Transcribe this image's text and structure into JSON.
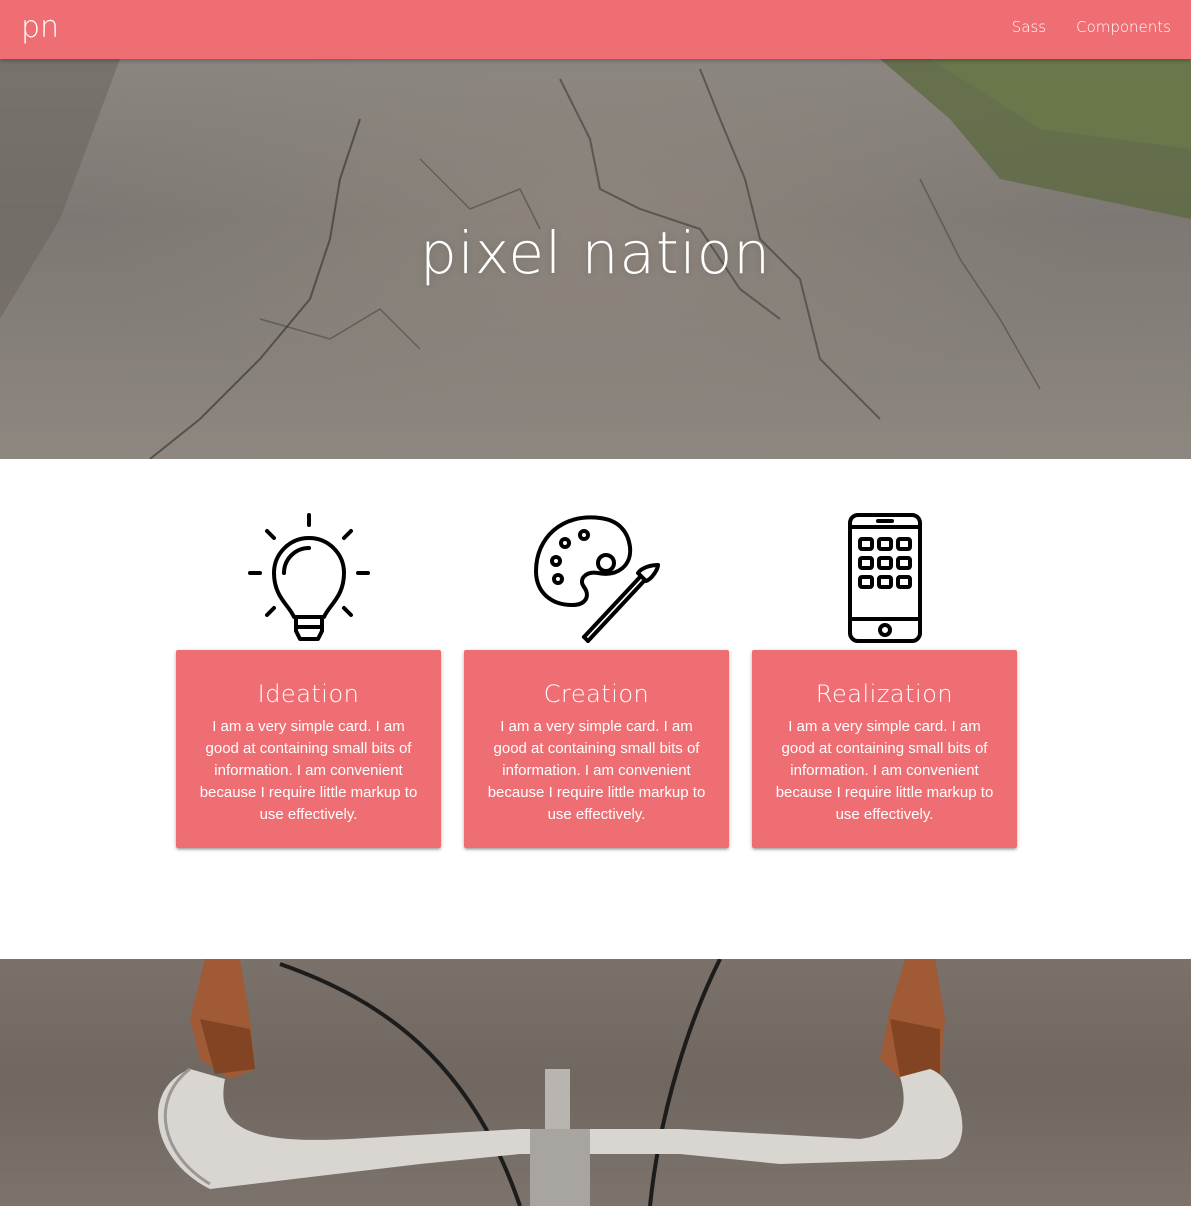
{
  "nav": {
    "brand": "pn",
    "links": [
      {
        "label": "Sass"
      },
      {
        "label": "Components"
      }
    ],
    "color": "#ee6e73"
  },
  "hero": {
    "title": "pixel nation"
  },
  "cards": [
    {
      "icon": "lightbulb-icon",
      "title": "Ideation",
      "text": "I am a very simple card. I am good at containing small bits of information. I am convenient because I require little markup to use effectively."
    },
    {
      "icon": "palette-icon",
      "title": "Creation",
      "text": "I am a very simple card. I am good at containing small bits of information. I am convenient because I require little markup to use effectively."
    },
    {
      "icon": "smartphone-icon",
      "title": "Realization",
      "text": "I am a very simple card. I am good at containing small bits of information. I am convenient because I require little markup to use effectively."
    }
  ]
}
